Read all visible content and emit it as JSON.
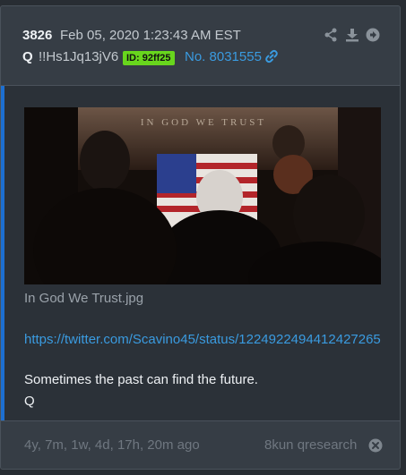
{
  "post": {
    "number": "3826",
    "date": "Feb 05, 2020 1:23:43 AM EST",
    "author": "Q",
    "tripcode": "!!Hs1Jq13jV6",
    "id_badge": "ID: 92ff25",
    "post_link": "No. 8031555",
    "image_caption_text": "IN GOD WE TRUST",
    "filename": "In God We Trust.jpg",
    "tweet_link": "https://twitter.com/Scavino45/status/1224922494412427265",
    "message": "Sometimes the past can find the future.",
    "signature": "Q"
  },
  "footer": {
    "ago": "4y, 7m, 1w, 4d, 17h, 20m ago",
    "board": "8kun qresearch"
  },
  "colors": {
    "accent": "#1d6fd1",
    "id_badge_bg": "#68d61d",
    "link": "#3a9be0"
  },
  "icons": [
    "share-icon",
    "download-icon",
    "arrow-right-icon",
    "link-icon",
    "close-circle-icon"
  ]
}
